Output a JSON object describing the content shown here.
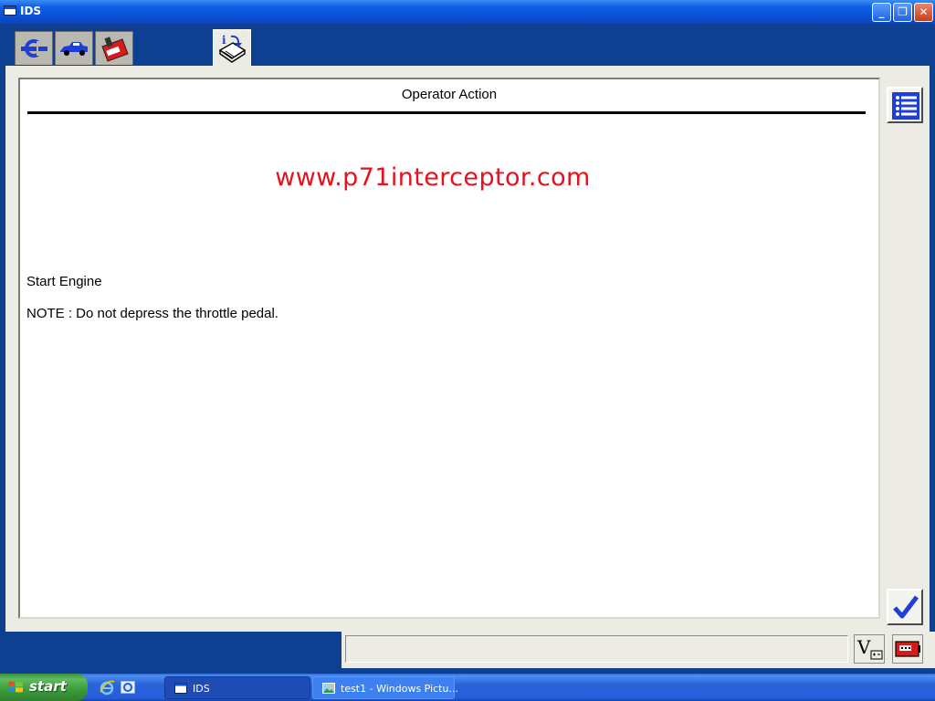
{
  "window": {
    "title": "IDS",
    "buttons": {
      "minimize": "_",
      "restore": "❐",
      "close": "✕"
    }
  },
  "toolbar": {
    "tabs": [
      {
        "icon": "connector-icon"
      },
      {
        "icon": "vehicle-icon"
      },
      {
        "icon": "toolbox-icon"
      },
      {
        "icon": "info-book-icon",
        "selected": true
      }
    ]
  },
  "main": {
    "heading": "Operator Action",
    "watermark": "www.p71interceptor.com",
    "instruction": "Start Engine",
    "note": "NOTE : Do not depress the throttle pedal."
  },
  "sidebar": {
    "list_button_icon": "list-icon",
    "confirm_button_icon": "checkmark-icon"
  },
  "statusbar": {
    "status_text": "",
    "voltage_icon": "voltage-icon",
    "battery_icon": "battery-icon"
  },
  "taskbar": {
    "start_label": "start",
    "items": [
      {
        "label": "IDS",
        "active": true
      },
      {
        "label": "test1 - Windows Pictu...",
        "active": false
      }
    ]
  },
  "colors": {
    "accent": "#0e3f90",
    "watermark": "#e8101a",
    "icon_blue": "#1d3fd6"
  }
}
